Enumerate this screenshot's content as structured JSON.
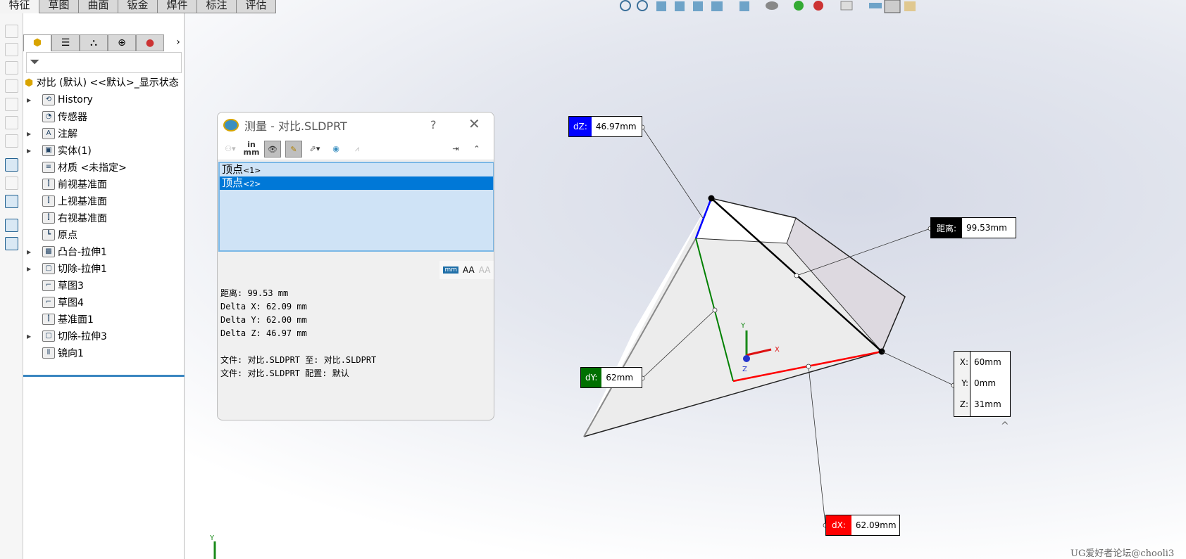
{
  "tabs": [
    "特征",
    "草图",
    "曲面",
    "钣金",
    "焊件",
    "标注",
    "评估"
  ],
  "active_tab": "特征",
  "panel": {
    "tabs": [
      "feature-manager",
      "property-manager",
      "configuration-manager",
      "dimxpert",
      "display-manager"
    ],
    "more": "›",
    "root": "对比 (默认) <<默认>_显示状态",
    "items": [
      {
        "label": "History",
        "expand": true,
        "icon": "history-folder"
      },
      {
        "label": "传感器",
        "expand": false,
        "icon": "sensor-folder"
      },
      {
        "label": "注解",
        "expand": true,
        "icon": "annotation-folder"
      },
      {
        "label": "实体(1)",
        "expand": true,
        "icon": "solid-bodies-folder"
      },
      {
        "label": "材质 <未指定>",
        "expand": false,
        "icon": "material"
      },
      {
        "label": "前视基准面",
        "expand": false,
        "icon": "plane"
      },
      {
        "label": "上视基准面",
        "expand": false,
        "icon": "plane"
      },
      {
        "label": "右视基准面",
        "expand": false,
        "icon": "plane"
      },
      {
        "label": "原点",
        "expand": false,
        "icon": "origin"
      },
      {
        "label": "凸台-拉伸1",
        "expand": true,
        "icon": "boss-extrude"
      },
      {
        "label": "切除-拉伸1",
        "expand": true,
        "icon": "cut-extrude"
      },
      {
        "label": "草图3",
        "expand": false,
        "icon": "sketch"
      },
      {
        "label": "草图4",
        "expand": false,
        "icon": "sketch"
      },
      {
        "label": "基准面1",
        "expand": false,
        "icon": "plane"
      },
      {
        "label": "切除-拉伸3",
        "expand": true,
        "icon": "cut-extrude"
      },
      {
        "label": "镜向1",
        "expand": false,
        "icon": "mirror"
      }
    ]
  },
  "dialog": {
    "title": "测量 - 对比.SLDPRT",
    "help": "?",
    "close": "✕",
    "units_label_top": "in",
    "units_label_bottom": "mm",
    "selections": [
      {
        "name": "顶点",
        "tag": "<1>"
      },
      {
        "name": "顶点",
        "tag": "<2>",
        "selected": true
      }
    ],
    "results": [
      "距离: 99.53 mm",
      "Delta X: 62.09 mm",
      "Delta Y: 62.00 mm",
      "Delta Z: 46.97 mm",
      "",
      "文件:  对比.SLDPRT 至:  对比.SLDPRT",
      "文件:  对比.SLDPRT 配置:  默认"
    ]
  },
  "callouts": {
    "dz": {
      "key": "dZ:",
      "value": "46.97mm",
      "color": "#0000ff"
    },
    "dist": {
      "key": "距离:",
      "value": "99.53mm",
      "color": "#000000"
    },
    "dy": {
      "key": "dY:",
      "value": "62mm",
      "color": "#007000"
    },
    "dx": {
      "key": "dX:",
      "value": "62.09mm",
      "color": "#ff0000"
    },
    "xyz": [
      {
        "key": "X:",
        "value": "60mm"
      },
      {
        "key": "Y:",
        "value": "0mm"
      },
      {
        "key": "Z:",
        "value": "31mm"
      }
    ]
  },
  "triad": {
    "x": "X",
    "y": "Y",
    "z": "Z"
  },
  "watermark": "UG爱好者论坛@chooli3"
}
